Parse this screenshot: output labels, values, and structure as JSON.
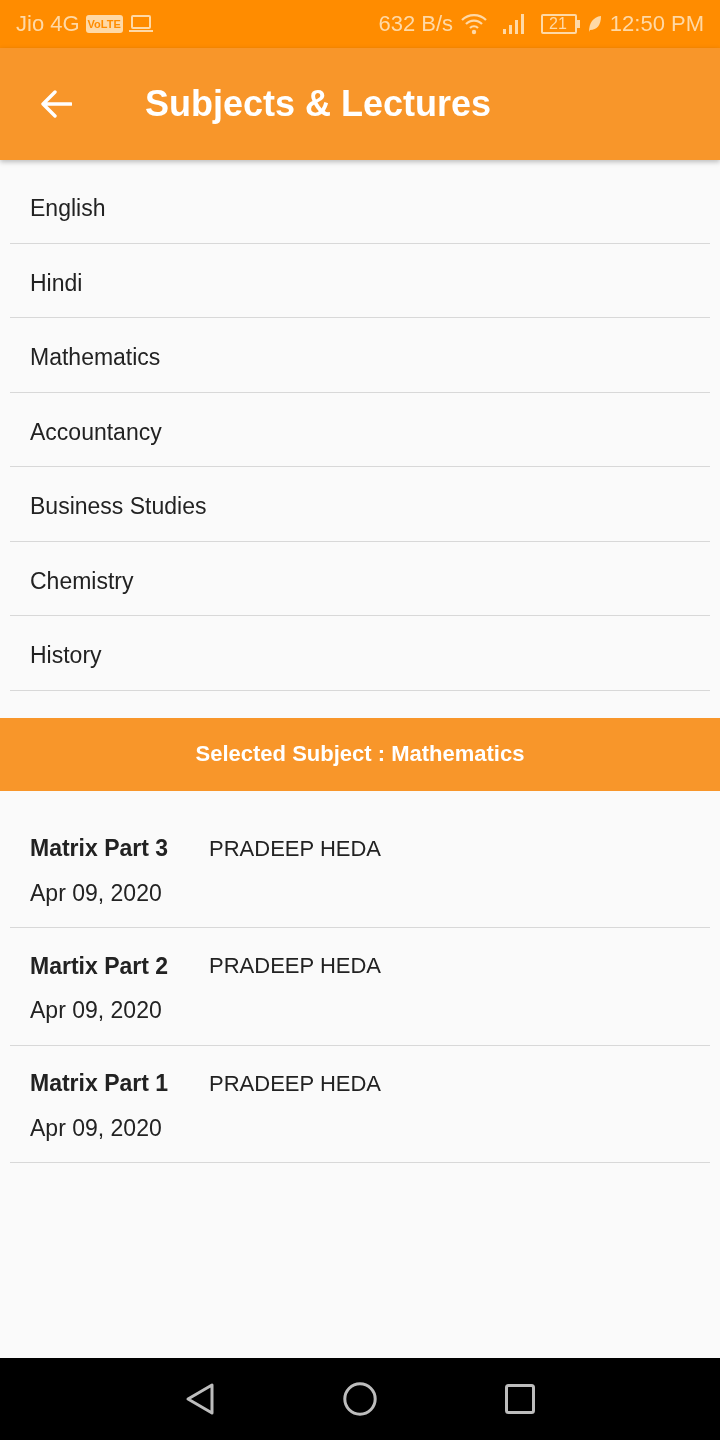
{
  "status_bar": {
    "carrier": "Jio 4G",
    "volte_badge": "VoLTE",
    "network_speed": "632 B/s",
    "battery": "21",
    "time": "12:50 PM"
  },
  "app_bar": {
    "title": "Subjects & Lectures"
  },
  "subjects": [
    {
      "name": "English"
    },
    {
      "name": "Hindi"
    },
    {
      "name": "Mathematics"
    },
    {
      "name": "Accountancy"
    },
    {
      "name": "Business Studies"
    },
    {
      "name": "Chemistry"
    },
    {
      "name": "History"
    }
  ],
  "selected_subject_banner": "Selected Subject : Mathematics",
  "lectures": [
    {
      "title": "Matrix Part 3",
      "author": "PRADEEP HEDA",
      "date": "Apr 09, 2020"
    },
    {
      "title": "Martix Part 2",
      "author": "PRADEEP HEDA",
      "date": "Apr 09, 2020"
    },
    {
      "title": "Matrix Part 1",
      "author": "PRADEEP HEDA",
      "date": "Apr 09, 2020"
    }
  ]
}
